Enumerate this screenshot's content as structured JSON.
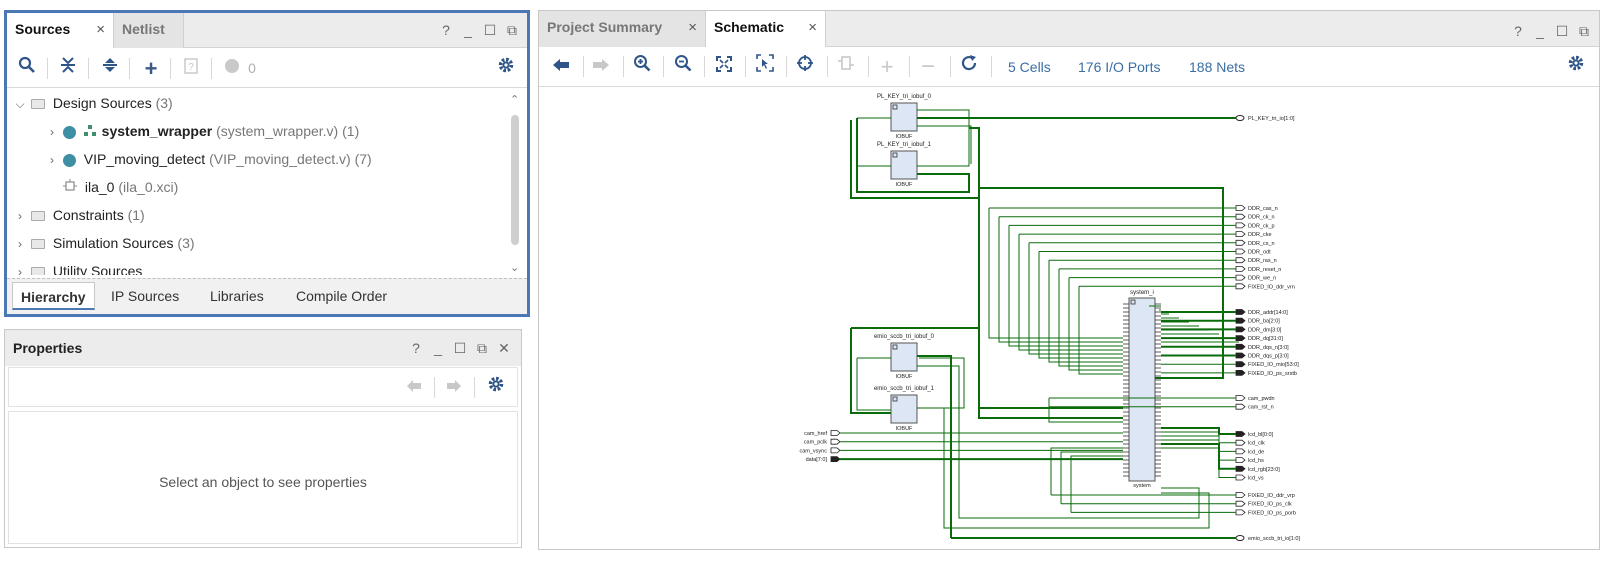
{
  "sources": {
    "tabs": [
      {
        "label": "Sources"
      },
      {
        "label": "Netlist"
      }
    ],
    "close_symbol": "×",
    "ctl": {
      "help": "?",
      "minimize": "_",
      "maximize": "☐",
      "float": "⧉"
    },
    "toolbar": {
      "count": "0"
    },
    "tree": {
      "design_sources": {
        "label": "Design Sources",
        "count": "(3)"
      },
      "items": [
        {
          "name": "system_wrapper",
          "file": "(system_wrapper.v)",
          "count": "(1)"
        },
        {
          "name": "VIP_moving_detect",
          "file": "(VIP_moving_detect.v)",
          "count": "(7)"
        },
        {
          "name": "ila_0",
          "file": "(ila_0.xci)",
          "count": ""
        }
      ],
      "constraints": {
        "label": "Constraints",
        "count": "(1)"
      },
      "simulation": {
        "label": "Simulation Sources",
        "count": "(3)"
      },
      "utility": {
        "label": "Utility Sources",
        "count": ""
      }
    },
    "bottom_tabs": [
      "Hierarchy",
      "IP Sources",
      "Libraries",
      "Compile Order"
    ]
  },
  "properties": {
    "title": "Properties",
    "empty_text": "Select an object to see properties",
    "ctl": {
      "close": "✕"
    }
  },
  "schematic": {
    "tabs": [
      {
        "label": "Project Summary"
      },
      {
        "label": "Schematic"
      }
    ],
    "stats": {
      "cells": "5 Cells",
      "ports": "176 I/O Ports",
      "nets": "188 Nets"
    },
    "cells": [
      {
        "inst": "PL_KEY_tri_iobuf_0",
        "type": "IOBUF"
      },
      {
        "inst": "PL_KEY_tri_iobuf_1",
        "type": "IOBUF"
      },
      {
        "inst": "emio_sccb_tri_iobuf_0",
        "type": "IOBUF"
      },
      {
        "inst": "emio_sccb_tri_iobuf_1",
        "type": "IOBUF"
      },
      {
        "inst": "system_i",
        "type": "system"
      }
    ],
    "input_ports": [
      "cam_href",
      "cam_pclk",
      "cam_vsync",
      "data[7:0]"
    ],
    "out_ports_top": [
      "PL_KEY_tri_io[1:0]"
    ],
    "out_ports_ddr": [
      "DDR_cas_n",
      "DDR_ck_n",
      "DDR_ck_p",
      "DDR_cke",
      "DDR_cs_n",
      "DDR_odt",
      "DDR_ras_n",
      "DDR_reset_n",
      "DDR_we_n",
      "FIXED_IO_ddr_vrn"
    ],
    "out_ports_bus": [
      "DDR_addr[14:0]",
      "DDR_ba[2:0]",
      "DDR_dm[3:0]",
      "DDR_dq[31:0]",
      "DDR_dqs_n[3:0]",
      "DDR_dqs_p[3:0]",
      "FIXED_IO_mio[53:0]",
      "FIXED_IO_ps_srstb"
    ],
    "out_ports_cam": [
      "cam_pwdn",
      "cam_rst_n"
    ],
    "out_ports_lcd": [
      "lcd_bl[0:0]",
      "lcd_clk",
      "lcd_de",
      "lcd_hs",
      "lcd_rgb[23:0]",
      "lcd_vs"
    ],
    "out_ports_fixed": [
      "FIXED_IO_ddr_vrp",
      "FIXED_IO_ps_clk",
      "FIXED_IO_ps_porb"
    ],
    "out_ports_bottom": [
      "emio_sccb_tri_io[1:0]"
    ],
    "wire_color": "#0a6b0a"
  }
}
